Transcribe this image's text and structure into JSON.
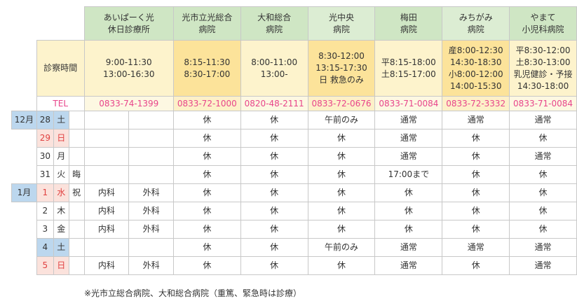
{
  "hospitals": [
    {
      "name1": "あいぱーく光",
      "name2": "休日診療所",
      "hours": [
        "9:00-11:30",
        "13:00-16:30"
      ],
      "tel": "0833-74-1399"
    },
    {
      "name1": "光市立光総合",
      "name2": "病院",
      "hours": [
        "8:15-11:30",
        "8:30-17:00"
      ],
      "tel": "0833-72-1000"
    },
    {
      "name1": "大和総合",
      "name2": "病院",
      "hours": [
        "8:00-11:00",
        "13:00-"
      ],
      "tel": "0820-48-2111"
    },
    {
      "name1": "光中央",
      "name2": "病院",
      "hours": [
        "8:30-12:00",
        "13:15-17:30",
        "日 救急のみ"
      ],
      "tel": "0833-72-0676"
    },
    {
      "name1": "梅田",
      "name2": "病院",
      "hours": [
        "平8:15-18:00",
        "土8:15-17:00"
      ],
      "tel": "0833-71-0084"
    },
    {
      "name1": "みちがみ",
      "name2": "病院",
      "hours": [
        "産8:00-12:30",
        "14:30-18:30",
        "小8:00-12:00",
        "14:00-15:30"
      ],
      "tel": "0833-72-3332"
    },
    {
      "name1": "やまて",
      "name2": "小児科病院",
      "hours": [
        "平8:30-12:00",
        "土8:30-13:00",
        "乳児健診・予接",
        "14:30-18:00"
      ],
      "tel": "0833-71-0084"
    }
  ],
  "labels": {
    "hours": "診察時間",
    "tel": "TEL"
  },
  "months": {
    "dec": "12月",
    "jan": "1月"
  },
  "rows": [
    {
      "day": "28",
      "dow": "土",
      "hol": "",
      "a1": "",
      "a2": "",
      "c": [
        "休",
        "休",
        "午前のみ",
        "通常",
        "通常",
        "通常"
      ],
      "type": "sat"
    },
    {
      "day": "29",
      "dow": "日",
      "hol": "",
      "a1": "",
      "a2": "",
      "c": [
        "休",
        "休",
        "休",
        "通常",
        "休",
        "休"
      ],
      "type": "sun"
    },
    {
      "day": "30",
      "dow": "月",
      "hol": "",
      "a1": "",
      "a2": "",
      "c": [
        "休",
        "休",
        "休",
        "通常",
        "休",
        "通常"
      ],
      "type": "wk"
    },
    {
      "day": "31",
      "dow": "火",
      "hol": "晦",
      "a1": "",
      "a2": "",
      "c": [
        "休",
        "休",
        "休",
        "17:00まで",
        "休",
        "休"
      ],
      "type": "wk"
    },
    {
      "day": "1",
      "dow": "水",
      "hol": "祝",
      "a1": "内科",
      "a2": "外科",
      "c": [
        "休",
        "休",
        "休",
        "休",
        "休",
        "休"
      ],
      "type": "hol"
    },
    {
      "day": "2",
      "dow": "木",
      "hol": "",
      "a1": "内科",
      "a2": "外科",
      "c": [
        "休",
        "休",
        "休",
        "休",
        "休",
        "休"
      ],
      "type": "wk"
    },
    {
      "day": "3",
      "dow": "金",
      "hol": "",
      "a1": "内科",
      "a2": "外科",
      "c": [
        "休",
        "休",
        "休",
        "休",
        "休",
        "休"
      ],
      "type": "wk"
    },
    {
      "day": "4",
      "dow": "土",
      "hol": "",
      "a1": "",
      "a2": "",
      "c": [
        "休",
        "休",
        "午前のみ",
        "通常",
        "通常",
        "通常"
      ],
      "type": "sat"
    },
    {
      "day": "5",
      "dow": "日",
      "hol": "",
      "a1": "内科",
      "a2": "外科",
      "c": [
        "休",
        "休",
        "休",
        "通常",
        "休",
        "通常"
      ],
      "type": "sun"
    }
  ],
  "note": "※光市立総合病院、大和総合病院（重篤、緊急時は診療）"
}
